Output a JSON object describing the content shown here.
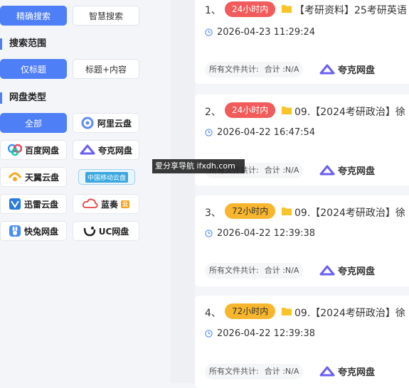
{
  "search_mode": {
    "precise_label": "精确搜索",
    "smart_label": "智慧搜索"
  },
  "scope": {
    "title": "搜索范围",
    "title_only_label": "仅标题",
    "title_content_label": "标题+内容"
  },
  "disk_type": {
    "title": "网盘类型",
    "all_label": "全部",
    "aliyun_label": "阿里云盘",
    "baidu_label": "百度网盘",
    "quark_label": "夸克网盘",
    "tianyi_label": "天翼云盘",
    "cmcc_label": "中国移动云盘",
    "xunlei_label": "迅雷云盘",
    "lanzou_label": "蓝奏",
    "lanzou_tag": "云",
    "kuaitu_label": "快兔网盘",
    "uc_label": "UC网盘"
  },
  "results": [
    {
      "index": "1、",
      "badge": "24小时内",
      "badge_color": "#f15b5b",
      "title": "【考研资料】25考研英语",
      "time": "2026-04-23 11:29:24",
      "summary_label": "所有文件共计:",
      "summary_value": "合计 :N/A",
      "disk": "夸克网盘"
    },
    {
      "index": "2、",
      "badge": "24小时内",
      "badge_color": "#f15b5b",
      "title": "09.【2024考研政治】徐",
      "time": "2026-04-22 16:47:54",
      "summary_label": "所有文件共计:",
      "summary_value": "合计 :N/A",
      "disk": "夸克网盘"
    },
    {
      "index": "3、",
      "badge": "72小时内",
      "badge_color": "#f7b62d",
      "title": "09.【2024考研政治】徐",
      "time": "2026-04-22 12:39:38",
      "summary_label": "所有文件共计:",
      "summary_value": "合计 :N/A",
      "disk": "夸克网盘"
    },
    {
      "index": "4、",
      "badge": "72小时内",
      "badge_color": "#f7b62d",
      "title": "09.【2024考研政治】徐",
      "time": "2026-04-22 12:39:38",
      "summary_label": "所有文件共计:",
      "summary_value": "合计 :N/A",
      "disk": "夸克网盘"
    }
  ],
  "watermark": "爱分享导航 ifxdh.com",
  "colors": {
    "accent": "#4f7ff6",
    "badge_24h": "#f15b5b",
    "badge_72h": "#f7b62d"
  }
}
